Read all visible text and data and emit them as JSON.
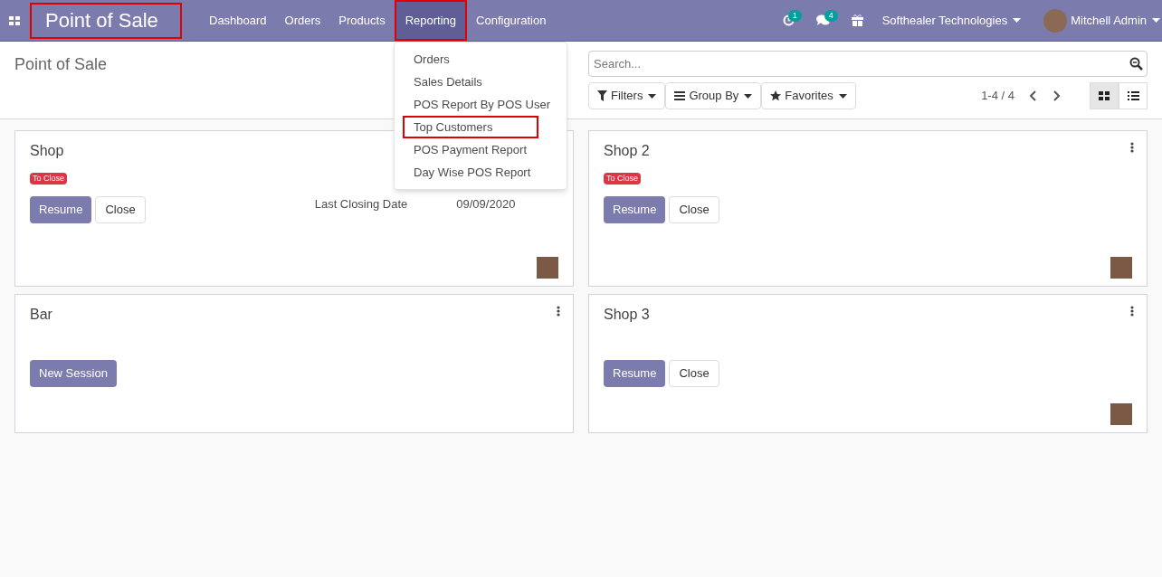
{
  "navbar": {
    "app_title": "Point of Sale",
    "app_title_highlighted": true,
    "menu": [
      {
        "label": "Dashboard",
        "selected": false,
        "highlighted": false
      },
      {
        "label": "Orders",
        "selected": false,
        "highlighted": false
      },
      {
        "label": "Products",
        "selected": false,
        "highlighted": false
      },
      {
        "label": "Reporting",
        "selected": true,
        "highlighted": true
      },
      {
        "label": "Configuration",
        "selected": false,
        "highlighted": false
      }
    ],
    "activity_count": "1",
    "message_count": "4",
    "company": "Softhealer Technologies",
    "user": "Mitchell Admin"
  },
  "reporting_dropdown": [
    {
      "label": "Orders",
      "highlighted": false
    },
    {
      "label": "Sales Details",
      "highlighted": false
    },
    {
      "label": "POS Report By POS User",
      "highlighted": false
    },
    {
      "label": "Top Customers",
      "highlighted": true
    },
    {
      "label": "POS Payment Report",
      "highlighted": false
    },
    {
      "label": "Day Wise POS Report",
      "highlighted": false
    }
  ],
  "control_panel": {
    "breadcrumb": "Point of Sale",
    "search": {
      "placeholder": "Search..."
    },
    "filters": [
      "Filters",
      "Group By",
      "Favorites"
    ],
    "pager": "1-4 / 4",
    "views": [
      {
        "kind": "kanban",
        "selected": true
      },
      {
        "kind": "list",
        "selected": false
      }
    ]
  },
  "cards": [
    {
      "name": "Shop",
      "status": "To Close",
      "menu": false,
      "buttons": [
        {
          "label": "Resume",
          "primary": true
        },
        {
          "label": "Close",
          "primary": false
        }
      ],
      "last_closing_label": "Last Closing Date",
      "last_closing_date": "09/09/2020",
      "avatar": true
    },
    {
      "name": "Shop 2",
      "status": "To Close",
      "menu": true,
      "buttons": [
        {
          "label": "Resume",
          "primary": true
        },
        {
          "label": "Close",
          "primary": false
        }
      ],
      "avatar": true
    },
    {
      "name": "Bar",
      "menu": true,
      "buttons": [
        {
          "label": "New Session",
          "primary": true
        }
      ],
      "avatar": false
    },
    {
      "name": "Shop 3",
      "menu": true,
      "buttons": [
        {
          "label": "Resume",
          "primary": true
        },
        {
          "label": "Close",
          "primary": false
        }
      ],
      "avatar": true
    }
  ]
}
